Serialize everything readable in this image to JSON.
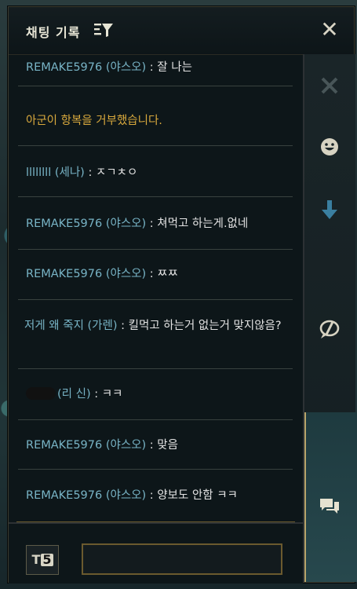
{
  "header": {
    "title": "채팅 기록",
    "filter_icon": "filter-icon",
    "close_label": "✕"
  },
  "messages": [
    {
      "sender": "REMAKE5976 (야스오)",
      "text": " : 잘 나는",
      "type": "player"
    },
    {
      "sender": "",
      "text": "아군이 항복을 거부했습니다.",
      "type": "system"
    },
    {
      "sender": "llllllll (세나)",
      "text": " : ㅈㄱㅊㅇ",
      "type": "player"
    },
    {
      "sender": "REMAKE5976 (야스오)",
      "text": " : 쳐먹고 하는게.없네",
      "type": "player"
    },
    {
      "sender": "REMAKE5976 (야스오)",
      "text": " : ㅉㅉ",
      "type": "player"
    },
    {
      "sender": "저게 왜 죽지 (가렌)",
      "text": " : 킬먹고 하는거 없는거 맞지않음?",
      "type": "player"
    },
    {
      "sender": "(리 신)",
      "text": " : ㅋㅋ",
      "type": "player",
      "redacted": true
    },
    {
      "sender": "REMAKE5976 (야스오)",
      "text": " : 맞음",
      "type": "player"
    },
    {
      "sender": "REMAKE5976 (야스오)",
      "text": " : 양보도 안함 ㅋㅋ",
      "type": "player"
    }
  ],
  "input": {
    "t5_label": "T",
    "t5_badge": "5",
    "value": ""
  },
  "side_panel": {
    "buttons": [
      "emote-icon",
      "download-icon",
      "mute-chat-icon",
      "chat-icon"
    ]
  },
  "colors": {
    "player_name": "#78b4c6",
    "system": "#d9a93d",
    "accent_gold": "#6b5a2e"
  }
}
